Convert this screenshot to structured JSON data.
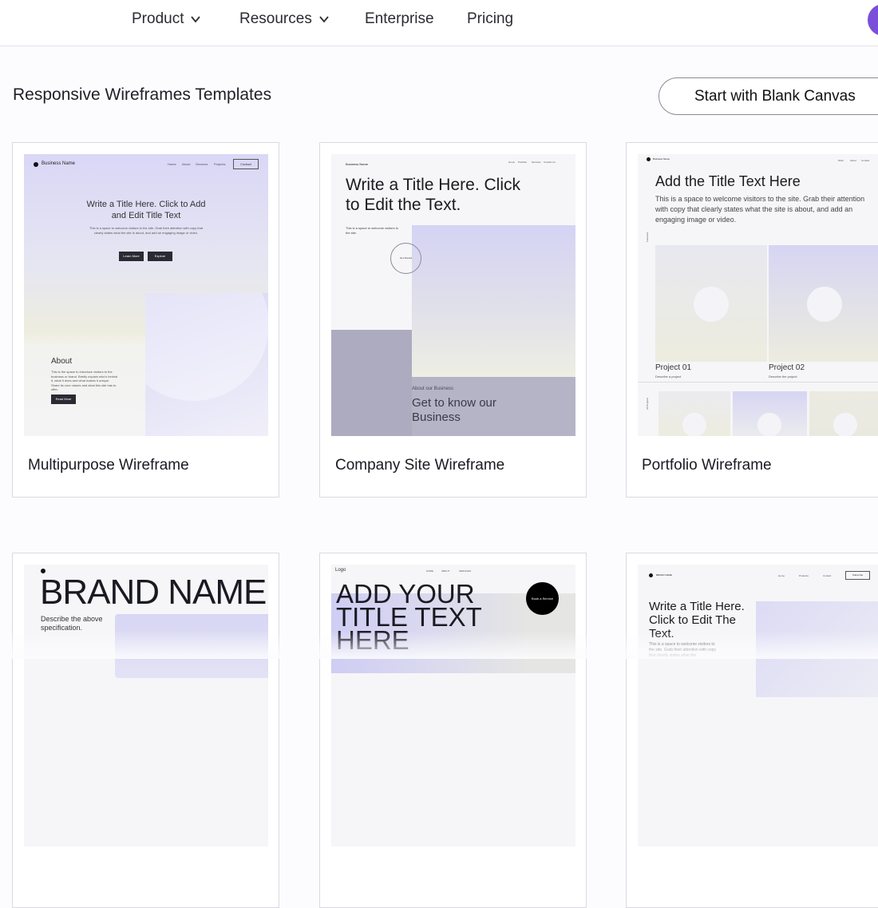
{
  "nav": {
    "items": [
      {
        "label": "Product",
        "has_dropdown": true
      },
      {
        "label": "Resources",
        "has_dropdown": true
      },
      {
        "label": "Enterprise",
        "has_dropdown": false
      },
      {
        "label": "Pricing",
        "has_dropdown": false
      }
    ],
    "avatar_color": "#7b4fd8"
  },
  "header": {
    "title": "Responsive Wireframes Templates",
    "blank_canvas_label": "Start with Blank Canvas"
  },
  "templates": [
    {
      "label": "Multipurpose Wireframe",
      "preview": {
        "brand": "Business Name",
        "menu": [
          "Home",
          "About",
          "Services",
          "Projects"
        ],
        "cta": "Contact",
        "title": "Write a Title Here. Click to Add and Edit Title Text",
        "body": "This is a space to welcome visitors to the site. Grab their attention with copy that clearly states what the site is about, and add an engaging image or video.",
        "btn1": "Learn More",
        "btn2": "Explore",
        "about_heading": "About",
        "about_body": "This is the space to introduce visitors to the business or brand. Briefly explain who's behind it, what it does and what makes it unique. Share its core values and what this site has to offer.",
        "about_btn": "Read More"
      }
    },
    {
      "label": "Company Site Wireframe",
      "preview": {
        "brand": "Business Name",
        "menu": [
          "Home",
          "Portfolio",
          "Services",
          "Contact Us"
        ],
        "title": "Write a Title Here. Click to Edit the Text.",
        "body": "This is a space to welcome visitors to the site.",
        "circle": "Get Started",
        "overline": "About our Business",
        "heading": "Get to know our Business"
      }
    },
    {
      "label": "Portfolio Wireframe",
      "preview": {
        "brand": "Business Name",
        "menu": [
          "Work",
          "About",
          "Contact"
        ],
        "title": "Add the Title Text Here",
        "body": "This is a space to welcome visitors to the site. Grab their attention with copy that clearly states what the site is about, and add an engaging image or video.",
        "side_featured": "Featured",
        "side_all": "All Projects",
        "project1": "Project 01",
        "project1_sub": "Describe a project",
        "project2": "Project 02",
        "project2_sub": "Describe the project"
      }
    },
    {
      "label": "",
      "preview": {
        "brand": "BRAND NAME",
        "body": "Describe the above specification."
      }
    },
    {
      "label": "",
      "preview": {
        "logo": "Logo",
        "menu": [
          "HOME",
          "ABOUT",
          "SERVICES"
        ],
        "title": "ADD YOUR TITLE TEXT HERE",
        "badge": "Book a Service"
      }
    },
    {
      "label": "",
      "preview": {
        "brand": "BRAND NAME",
        "menu": [
          "Home",
          "Products",
          "Contact"
        ],
        "cta": "Subscribe",
        "title": "Write a Title Here. Click to Edit The Text.",
        "body": "This is a space to welcome visitors to the site. Grab their attention with copy that clearly states what the"
      }
    }
  ]
}
